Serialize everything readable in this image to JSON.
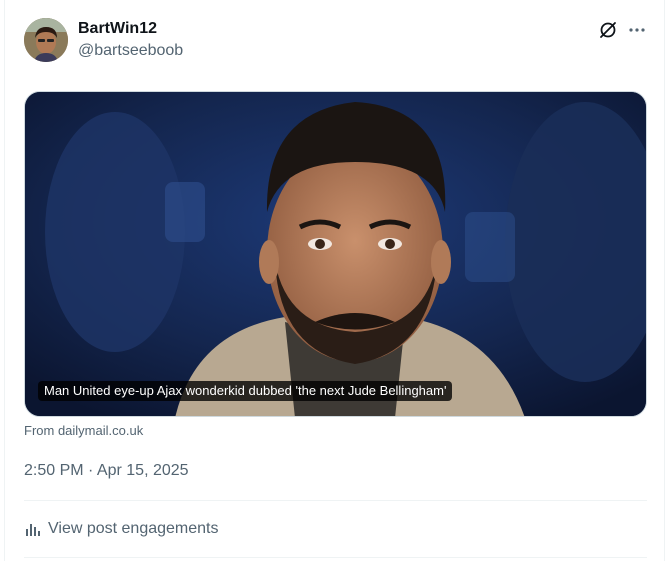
{
  "post": {
    "display_name": "BartWin12",
    "handle": "@bartseeboob",
    "card": {
      "headline": "Man United eye-up Ajax wonderkid dubbed 'the next Jude Bellingham'",
      "source": "From dailymail.co.uk",
      "image_icon": "news-photo-image"
    },
    "timestamp": "2:50 PM · Apr 15, 2025",
    "engagements_label": "View post engagements"
  },
  "icons": {
    "grok": "grok-icon",
    "more": "more-icon",
    "engagements": "bar-chart-icon"
  },
  "colors": {
    "text_primary": "#0f1419",
    "text_secondary": "#536471",
    "divider": "#eff3f4"
  }
}
